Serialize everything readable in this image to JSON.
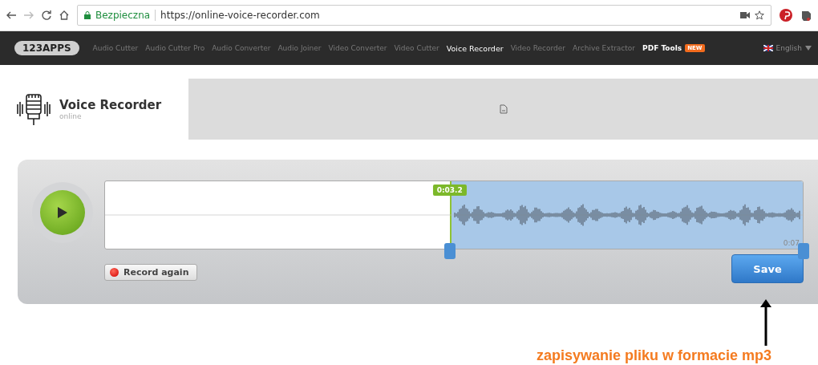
{
  "browser": {
    "secure_label": "Bezpieczna",
    "url": "https://online-voice-recorder.com"
  },
  "nav": {
    "logo": "123APPS",
    "items": [
      {
        "label": "Audio Cutter",
        "selected": false,
        "emphasized": false
      },
      {
        "label": "Audio Cutter Pro",
        "selected": false,
        "emphasized": false
      },
      {
        "label": "Audio Converter",
        "selected": false,
        "emphasized": false
      },
      {
        "label": "Audio Joiner",
        "selected": false,
        "emphasized": false
      },
      {
        "label": "Video Converter",
        "selected": false,
        "emphasized": false
      },
      {
        "label": "Video Cutter",
        "selected": false,
        "emphasized": false
      },
      {
        "label": "Voice Recorder",
        "selected": true,
        "emphasized": false
      },
      {
        "label": "Video Recorder",
        "selected": false,
        "emphasized": false
      },
      {
        "label": "Archive Extractor",
        "selected": false,
        "emphasized": false
      },
      {
        "label": "PDF Tools",
        "selected": false,
        "emphasized": true,
        "badge": "NEW"
      }
    ],
    "language": "English"
  },
  "app": {
    "title": "Voice Recorder",
    "subtitle": "online"
  },
  "editor": {
    "selection": {
      "level": 0.494
    },
    "start_time": "0:03.2",
    "end_time": "0:07",
    "record_again": "Record again",
    "save": "Save"
  },
  "annotation": "zapisywanie pliku w formacie mp3"
}
